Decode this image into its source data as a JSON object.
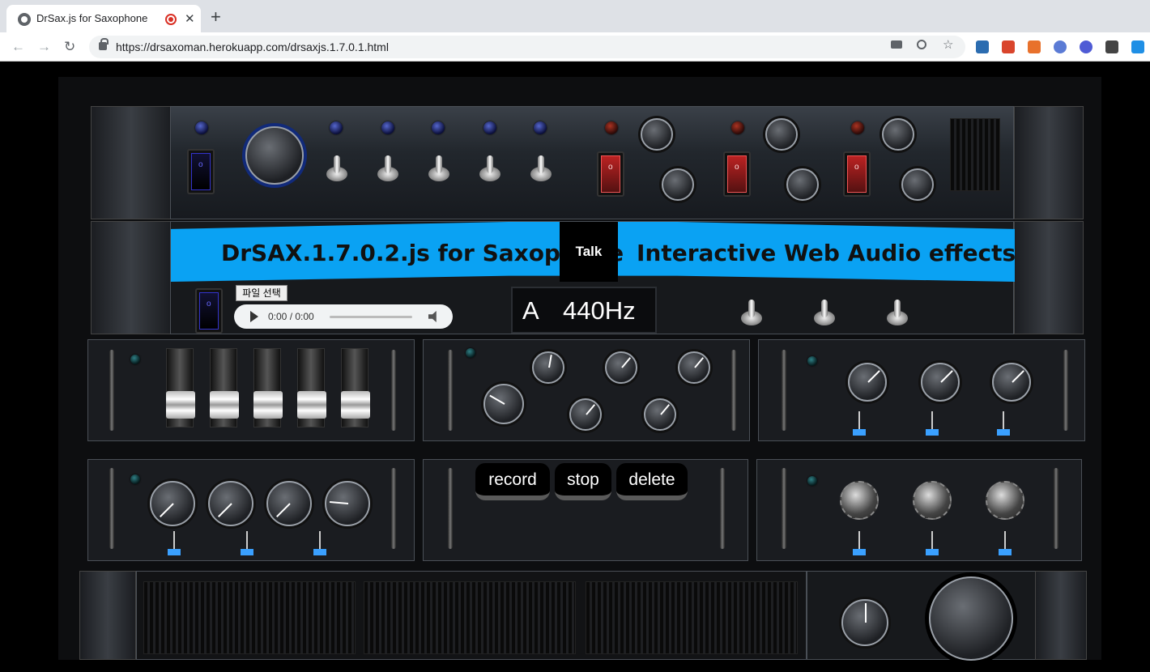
{
  "browser": {
    "tab_title": "DrSax.js for Saxophone",
    "tab_close": "✕",
    "new_tab": "+",
    "url": "https://drsaxoman.herokuapp.com/drsaxjs.1.7.0.1.html",
    "back": "←",
    "forward": "→",
    "reload": "↻",
    "omnibox_icons": [
      "camera-icon",
      "zoom-icon",
      "star-icon"
    ],
    "extension_icons": [
      "ext-1",
      "ext-2",
      "ext-3",
      "ext-4",
      "ext-5",
      "ext-6",
      "ext-7"
    ]
  },
  "header": {
    "title": "DrSAX.1.7.0.2.js for Saxophone",
    "talk_button": "Talk",
    "subtitle": "Interactive Web Audio effects"
  },
  "player": {
    "file_button": "파일 선택",
    "time": "0:00 / 0:00"
  },
  "tuner": {
    "note": "A",
    "frequency": "440Hz"
  },
  "switches": {
    "blue_on": "o",
    "blue_off": "|",
    "red_on": "o",
    "red_off": "|"
  },
  "recorder": {
    "record_label": "record",
    "stop_label": "stop",
    "delete_label": "delete"
  },
  "colors": {
    "banner": "#0aa2f3",
    "slider_handle": "#3aa0ff"
  }
}
